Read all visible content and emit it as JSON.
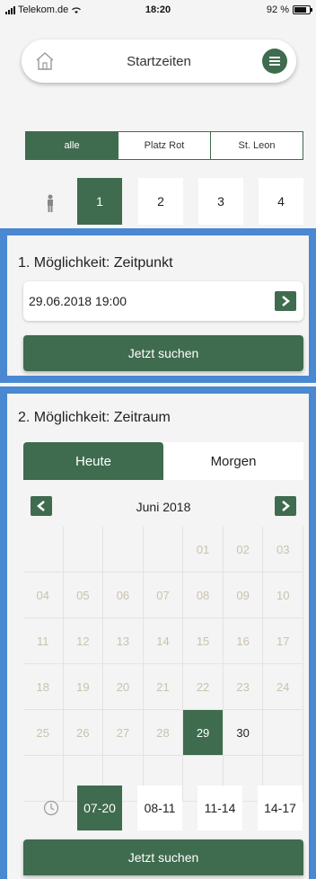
{
  "status_bar": {
    "carrier": "Telekom.de",
    "time": "18:20",
    "battery": "92 %",
    "battery_level": 0.92
  },
  "header": {
    "title": "Startzeiten",
    "home_icon": "home-icon",
    "menu_icon": "hamburger-menu-icon"
  },
  "course_filter": {
    "options": [
      "alle",
      "Platz Rot",
      "St. Leon"
    ],
    "selected": "alle"
  },
  "players": {
    "icon": "person-icon",
    "options": [
      "1",
      "2",
      "3",
      "4"
    ],
    "selected": "1"
  },
  "option1": {
    "title": "1. Möglichkeit: Zeitpunkt",
    "datetime": "29.06.2018 19:00",
    "search_label": "Jetzt suchen"
  },
  "option2": {
    "title": "2. Möglichkeit: Zeitraum",
    "tabs": [
      "Heute",
      "Morgen"
    ],
    "selected_tab": "Heute",
    "month_label": "Juni 2018",
    "calendar": {
      "days": [
        "",
        "",
        "",
        "",
        "01",
        "02",
        "03",
        "04",
        "05",
        "06",
        "07",
        "08",
        "09",
        "10",
        "11",
        "12",
        "13",
        "14",
        "15",
        "16",
        "17",
        "18",
        "19",
        "20",
        "21",
        "22",
        "23",
        "24",
        "25",
        "26",
        "27",
        "28",
        "29",
        "30",
        "",
        "",
        "",
        "",
        "",
        "",
        "",
        ""
      ],
      "selected": "29",
      "available": [
        "29",
        "30"
      ]
    },
    "time_slots": [
      "07-20",
      "08-11",
      "11-14",
      "14-17"
    ],
    "selected_slot": "07-20",
    "search_label": "Jetzt suchen"
  },
  "colors": {
    "primary": "#3f6b4f",
    "highlight_frame": "#4a88d2",
    "background": "#f4f4f4"
  }
}
